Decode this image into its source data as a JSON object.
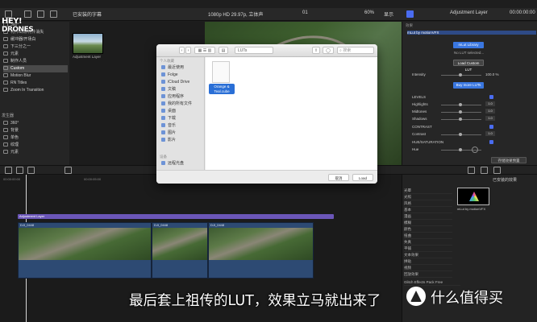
{
  "topbar": {
    "library": "已安装的字幕",
    "resolution": "1080p HD 29.97p, 立体声",
    "clip_name": "01",
    "zoom": "60%",
    "view": "显示",
    "inspector_title": "Adjustment Layer",
    "timecode": "00:00:00:00"
  },
  "sidebar": {
    "items": [
      "360°",
      "构件出现/构件消失",
      "缓冲器/开场白",
      "下三分之一",
      "元素",
      "制作人员",
      "Custom",
      "Motion Blur",
      "RN Titles",
      "Zoom In Transition"
    ],
    "selected_index": 6,
    "section_head": "发生器",
    "sub_items": [
      "360°",
      "背景",
      "单色",
      "纹理",
      "元素"
    ]
  },
  "browser": {
    "thumb_label": "Adjustment Layer"
  },
  "inspector": {
    "section": "效果",
    "plugin": "mLut by motionVFX",
    "btn_lut_library": "mLut Library",
    "no_lut": "No LUT selected...",
    "btn_load_custom": "Load Custom LUT",
    "intensity_label": "Intensity",
    "intensity_value": "100.0 %",
    "btn_buy_more": "Buy more LUTs",
    "levels": "LEVELS",
    "highlights": "Highlights",
    "highlights_val": "1.0",
    "midtones": "Midtones",
    "midtones_val": "1.0",
    "shadows": "Shadows",
    "shadows_val": "1.0",
    "contrast": "CONTRAST",
    "contrast_sub": "Contrast",
    "contrast_val": "1.0",
    "huesat": "HUE/SATURATION",
    "hue": "Hue",
    "save_preset": "存储效果预置"
  },
  "timeline": {
    "adjustment_clip": "Adjustment Layer",
    "clip1_label": "DJI_0448",
    "clip2_label": "DJI_0448",
    "clip3_label": "DJI_0448",
    "ruler": [
      "00:00:00:00",
      "00:00:05:00",
      "00:00:10:00",
      "00:00:15:00",
      "00:00:20:00"
    ]
  },
  "effects": {
    "header": "已安装的效果",
    "categories": [
      "光晕",
      "光照",
      "风格",
      "基本",
      "漫画",
      "模糊",
      "颜色",
      "扭曲",
      "失真",
      "平铺",
      "文本效果",
      "拼贴",
      "视频",
      "回放效果",
      "Glitch Effects Pack Free"
    ],
    "item_label": "mLut by motionVFX"
  },
  "dialog": {
    "path": "LUTs",
    "search_placeholder": "搜索",
    "favorites_head": "个人收藏",
    "favorites": [
      "最近使用",
      "Folge",
      "iCloud Drive",
      "文稿",
      "应用程序",
      "我的所有文件",
      "桌面",
      "下载",
      "音乐",
      "图片",
      "影片"
    ],
    "devices_head": "设备",
    "devices": [
      "远程光盘"
    ],
    "file_name": "Orange & Teal.cube",
    "cancel": "取消",
    "load": "Load"
  },
  "subtitle": "最后套上祖传的LUT，效果立马就出来了",
  "watermark": {
    "logo_line1": "HEY!",
    "logo_line2": "DRONES",
    "logo_sub": "TEAM",
    "text": "什么值得买"
  },
  "colors": {
    "accent_blue": "#2a6fd6",
    "clip_blue": "#2d4a73",
    "button_blue": "#3a77e0",
    "subtitle_white": "#ffffff"
  }
}
